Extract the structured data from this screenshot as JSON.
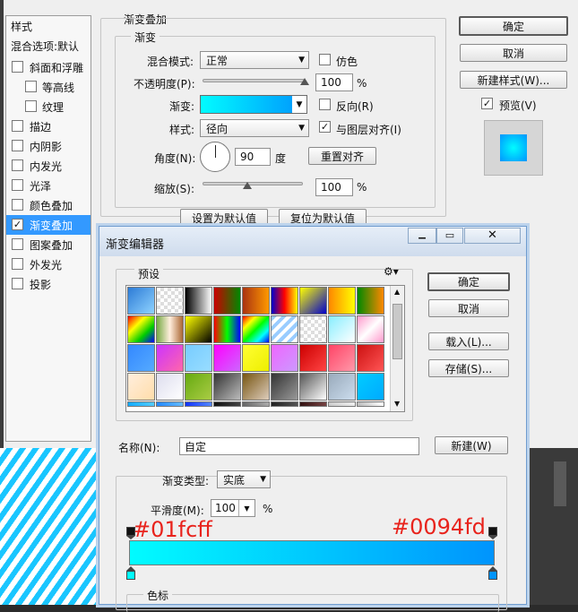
{
  "layer_style": {
    "sidebar": {
      "title": "样式",
      "blend_default": "混合选项:默认",
      "items": [
        {
          "label": "斜面和浮雕",
          "checked": false,
          "indent": false
        },
        {
          "label": "等高线",
          "checked": false,
          "indent": true
        },
        {
          "label": "纹理",
          "checked": false,
          "indent": true
        },
        {
          "label": "描边",
          "checked": false,
          "indent": false
        },
        {
          "label": "内阴影",
          "checked": false,
          "indent": false
        },
        {
          "label": "内发光",
          "checked": false,
          "indent": false
        },
        {
          "label": "光泽",
          "checked": false,
          "indent": false
        },
        {
          "label": "颜色叠加",
          "checked": false,
          "indent": false
        },
        {
          "label": "渐变叠加",
          "checked": true,
          "indent": false,
          "selected": true
        },
        {
          "label": "图案叠加",
          "checked": false,
          "indent": false
        },
        {
          "label": "外发光",
          "checked": false,
          "indent": false
        },
        {
          "label": "投影",
          "checked": false,
          "indent": false
        }
      ]
    },
    "section_title": "渐变叠加",
    "group_title": "渐变",
    "blend_mode_label": "混合模式:",
    "blend_mode_value": "正常",
    "dither_label": "仿色",
    "opacity_label": "不透明度(P):",
    "opacity_value": "100",
    "opacity_unit": "%",
    "opacity_fraction": 1.0,
    "gradient_label": "渐变:",
    "reverse_label": "反向(R)",
    "style_label": "样式:",
    "style_value": "径向",
    "align_label": "与图层对齐(I)",
    "align_checked": true,
    "angle_label": "角度(N):",
    "angle_value": "90",
    "angle_unit": "度",
    "reset_align_label": "重置对齐",
    "scale_label": "缩放(S):",
    "scale_value": "100",
    "scale_unit": "%",
    "scale_fraction": 0.45,
    "set_default_label": "设置为默认值",
    "reset_default_label": "复位为默认值",
    "ok_label": "确定",
    "cancel_label": "取消",
    "new_style_label": "新建样式(W)...",
    "preview_label": "预览(V)",
    "preview_checked": true
  },
  "gradient_editor": {
    "title": "渐变编辑器",
    "presets_label": "预设",
    "gear_icon": "gear-icon",
    "ok_label": "确定",
    "cancel_label": "取消",
    "load_label": "载入(L)...",
    "save_label": "存储(S)...",
    "name_label": "名称(N):",
    "name_value": "自定",
    "new_label": "新建(W)",
    "gradient_type_label": "渐变类型:",
    "gradient_type_value": "实底",
    "smoothness_label": "平滑度(M):",
    "smoothness_value": "100",
    "smoothness_unit": "%",
    "color_stop_left": "#01fcff",
    "color_stop_right": "#0094fd",
    "color_stops_label": "色标",
    "colors": {
      "start": "#01fcff",
      "end": "#0094fd",
      "annotation": "#e8231c"
    }
  }
}
